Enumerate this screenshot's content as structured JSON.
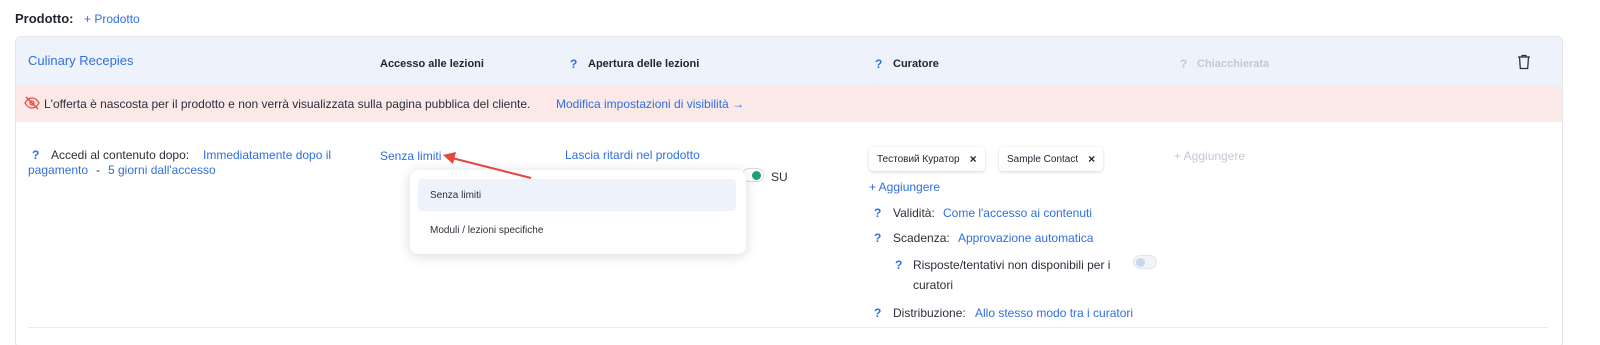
{
  "header": {
    "label": "Prodotto:",
    "add_product": "+ Prodotto"
  },
  "product": {
    "name": "Culinary Recepies",
    "columns": {
      "access": "Accesso alle lezioni",
      "opening": "Apertura delle lezioni",
      "curator": "Curatore",
      "chat": "Chiacchierata"
    },
    "q_mark": "?"
  },
  "notice": {
    "text": "L'offerta è nascosta per il prodotto e non verrà visualizzata sulla pagina pubblica del cliente.",
    "link": "Modifica impostazioni di visibilità →"
  },
  "access_row": {
    "label": "Accedi al contenuto dopo:",
    "value_line1": "Immediatamente dopo il",
    "value_line2": "pagamento",
    "separator": "-",
    "days": "5 giorni dall'accesso"
  },
  "lesson_access": {
    "value": "Senza limiti",
    "dropdown": [
      "Senza limiti",
      "Moduli / lezioni specifiche"
    ]
  },
  "opening": {
    "value": "Lascia ritardi nel prodotto",
    "toggle_label": "SU",
    "toggle_on": true
  },
  "curators": {
    "chips": [
      "Тестовий Куратор",
      "Sample Contact"
    ],
    "chip_remove": "×",
    "add": "+ Aggiungere",
    "validity_label": "Validità:",
    "validity_value": "Come l'accesso ai contenuti",
    "deadline_label": "Scadenza:",
    "deadline_value": "Approvazione automatica",
    "answers_line1": "Risposte/tentativi non disponibili per i",
    "answers_line2": "curatori",
    "answers_toggle_on": false,
    "distribution_label": "Distribuzione:",
    "distribution_value": "Allo stesso modo tra i curatori"
  },
  "chat": {
    "add": "+ Aggiungere"
  },
  "colors": {
    "link": "#2f6fe0",
    "header_bg": "#eef3fb",
    "notice_bg": "#fbe9e8",
    "toggle_on": "#22a06b",
    "annotation_arrow": "#e8453c"
  }
}
